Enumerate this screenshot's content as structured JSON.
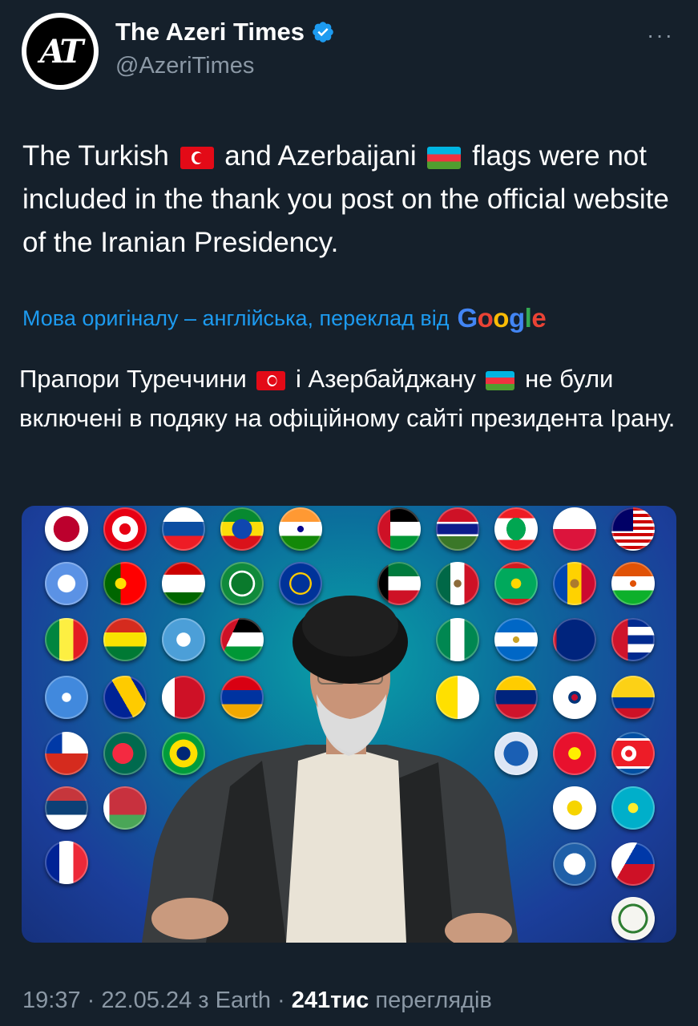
{
  "account": {
    "avatar_text": "AT",
    "display_name": "The Azeri Times",
    "handle": "@AzeriTimes",
    "verified": true
  },
  "menu": {
    "more_label": "···"
  },
  "tweet": {
    "part1": "The Turkish ",
    "part2": " and Azerbaijani ",
    "part3": " flags were not included in the thank you post on the official website of the Iranian Presidency."
  },
  "translation": {
    "notice": "Мова оригіналу – англійська, переклад від",
    "provider": "Google",
    "part1": "Прапори Туреччини ",
    "part2": " і Азербайджану ",
    "part3": " не були включені в подяку на офіційному сайті президента Ірану."
  },
  "footer": {
    "time": "19:37",
    "sep1": " · ",
    "date": "22.05.24",
    "source": " з Earth",
    "sep2": " · ",
    "views": "241тис",
    "views_label": " переглядів"
  },
  "colors": {
    "background": "#15202b",
    "link": "#1d9bf0",
    "secondary_text": "#8b98a5",
    "verified": "#1d9bf0"
  }
}
